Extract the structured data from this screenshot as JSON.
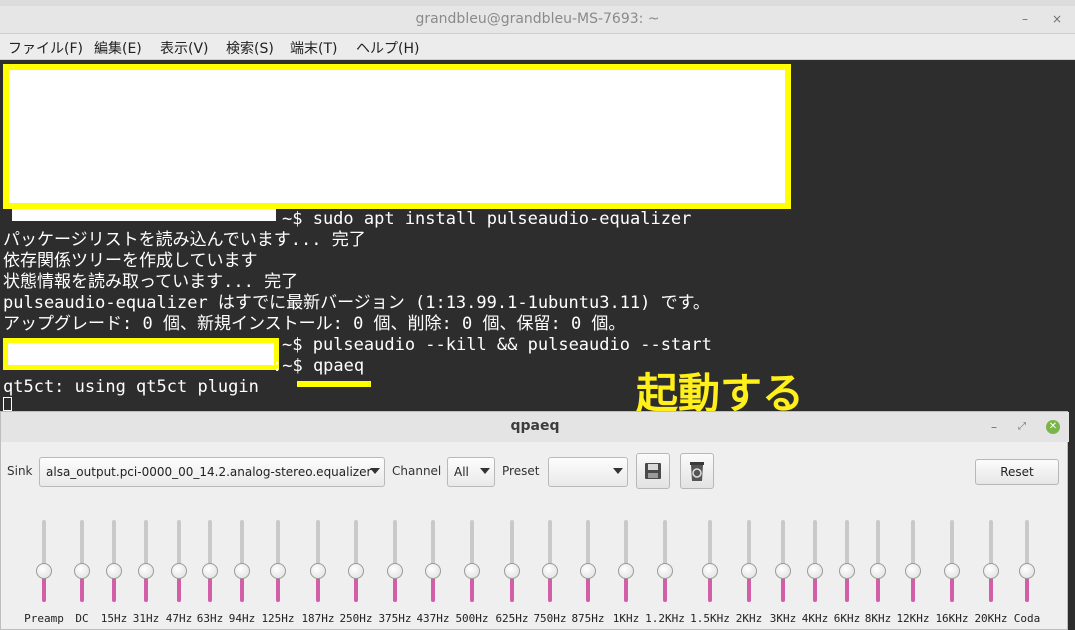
{
  "terminal": {
    "title": "grandbleu@grandbleu-MS-7693: ~",
    "menu": [
      "ファイル(F)",
      "編集(E)",
      "表示(V)",
      "検索(S)",
      "端末(T)",
      "ヘルプ(H)"
    ],
    "lines": [
      "~$ sudo apt install pulseaudio-equalizer",
      "パッケージリストを読み込んでいます... 完了",
      "依存関係ツリーを作成しています",
      "状態情報を読み取っています... 完了",
      "pulseaudio-equalizer はすでに最新バージョン (1:13.99.1-1ubuntu3.11) です。",
      "アップグレード: 0 個、新規インストール: 0 個、削除: 0 個、保留: 0 個。",
      "~$ pulseaudio --kill && pulseaudio --start",
      ":~$ qpaeq",
      "qt5ct: using qt5ct plugin"
    ],
    "annotation": "起動する",
    "colors": {
      "background": "#2d2d2d",
      "text": "#ffffff",
      "highlight": "#ffff00"
    }
  },
  "qpaeq": {
    "title": "qpaeq",
    "sink_label": "Sink",
    "sink_value": "alsa_output.pci-0000_00_14.2.analog-stereo.equalizer",
    "channel_label": "Channel",
    "channel_value": "All",
    "preset_label": "Preset",
    "preset_value": "",
    "save_icon": "floppy-save-icon",
    "delete_icon": "recycle-bin-icon",
    "reset_label": "Reset",
    "slider_level": 0.5,
    "bands": [
      "Preamp",
      "DC",
      "15Hz",
      "31Hz",
      "47Hz",
      "63Hz",
      "94Hz",
      "125Hz",
      "187Hz",
      "250Hz",
      "375Hz",
      "437Hz",
      "500Hz",
      "625Hz",
      "750Hz",
      "875Hz",
      "1KHz",
      "1.2KHz",
      "1.5KHz",
      "2KHz",
      "3KHz",
      "4KHz",
      "6KHz",
      "8KHz",
      "12KHz",
      "16KHz",
      "20KHz",
      "Coda"
    ],
    "colors": {
      "slider_fill": "#d35ea8",
      "close_button": "#7ab547"
    }
  }
}
